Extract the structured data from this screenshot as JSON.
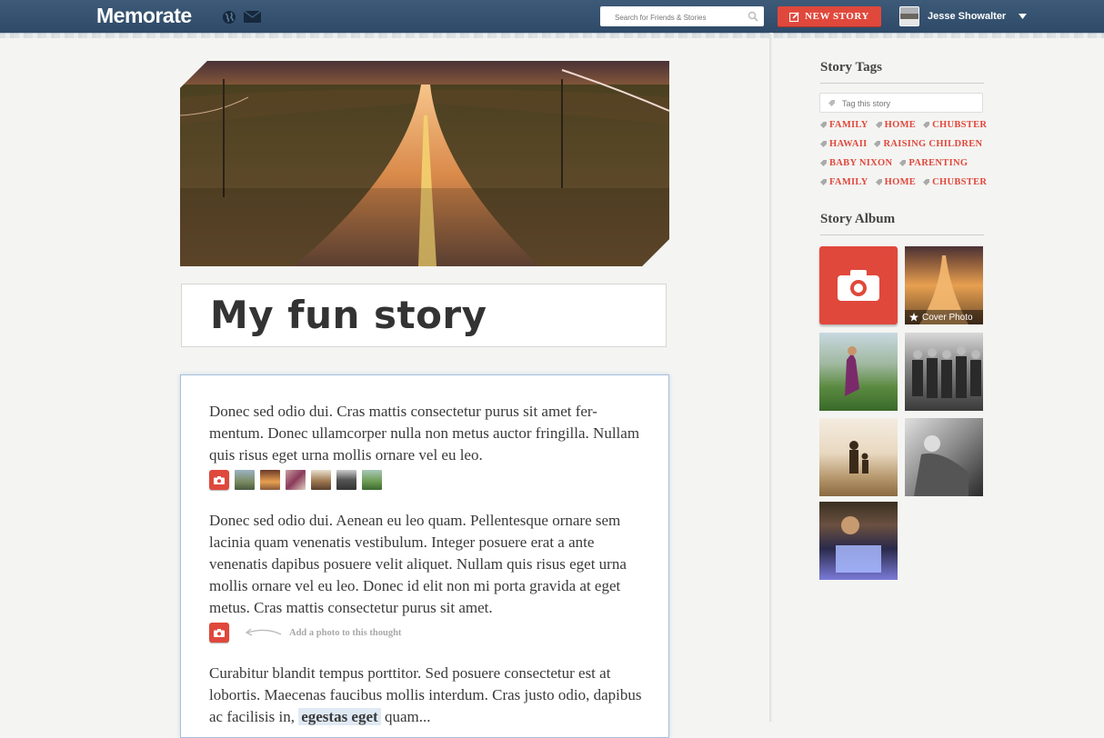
{
  "header": {
    "logo": "Memorate",
    "search_placeholder": "Search for Friends & Stories",
    "new_story_label": "NEW STORY",
    "user_name": "Jesse Showalter"
  },
  "story": {
    "title": "My fun story",
    "paragraphs": [
      "Donec sed odio dui. Cras mattis consectetur purus sit amet fer-mentum. Donec ullamcorper nulla non metus auctor fringilla. Nullam quis risus eget urna mollis ornare vel eu leo.",
      "Donec sed odio dui. Aenean eu leo quam. Pellentesque ornare sem lacinia quam venenatis vestibulum. Integer posuere erat a ante venenatis dapibus posuere velit aliquet. Nullam quis risus eget urna mollis ornare vel eu leo. Donec id elit non mi porta gravida at eget metus. Cras mattis consectetur purus sit amet."
    ],
    "paragraph3_start": "Curabitur blandit tempus porttitor. Sed posuere consectetur est at lobortis. Maecenas faucibus mollis interdum. Cras justo odio, dapibus ac facilisis in, ",
    "paragraph3_highlight": "egestas eget",
    "paragraph3_end": " quam...",
    "add_photo_hint": "Add a photo to this thought"
  },
  "sidebar": {
    "tags_title": "Story Tags",
    "tag_placeholder": "Tag this story",
    "tag_rows": [
      [
        "FAMILY",
        "HOME",
        "CHUBSTER"
      ],
      [
        "HAWAII",
        "RAISING CHILDREN"
      ],
      [
        "BABY NIXON",
        "PARENTING"
      ],
      [
        "FAMILY",
        "HOME",
        "CHUBSTER"
      ]
    ],
    "album_title": "Story Album",
    "cover_photo_label": "Cover Photo"
  },
  "colors": {
    "header_bg": "#34506f",
    "accent_red": "#e0483c",
    "body_border": "#a7bfdc"
  },
  "icons": [
    "globe-icon",
    "mail-icon",
    "search-icon",
    "pencil-icon",
    "caret-down-icon",
    "tag-icon",
    "camera-icon",
    "star-icon",
    "arrow-icon"
  ]
}
